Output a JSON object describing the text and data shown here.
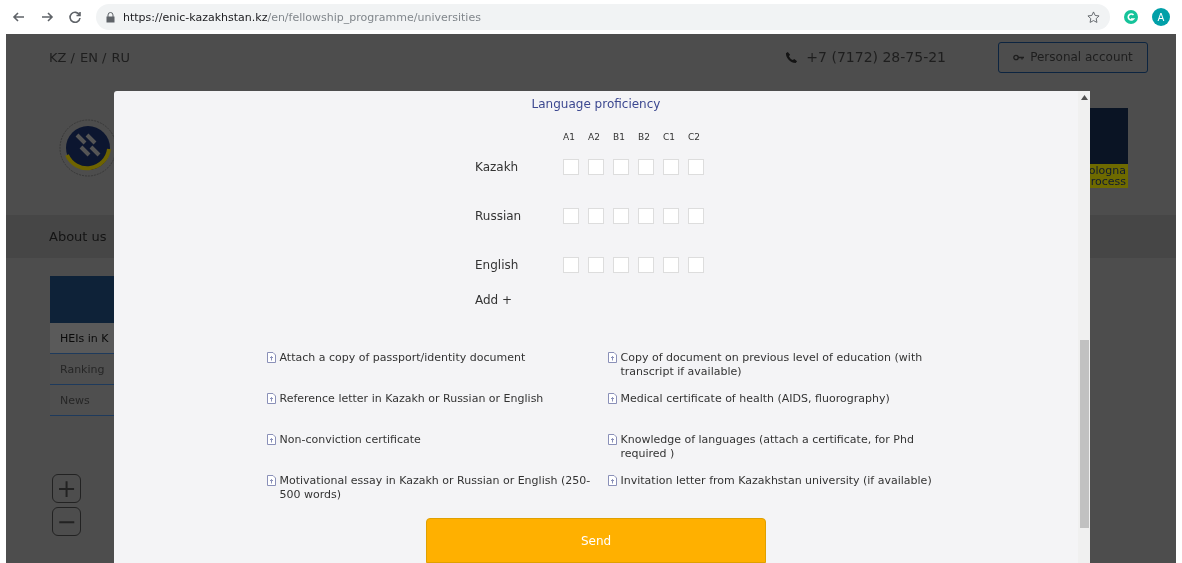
{
  "browser": {
    "url_host": "https://enic-kazakhstan.kz",
    "url_path": "/en/fellowship_programme/universities",
    "profile_initial": "A"
  },
  "site": {
    "languages": [
      "KZ /",
      "EN /",
      "RU"
    ],
    "phone": "+7 (7172) 28-75-21",
    "account_button": "Personal account",
    "right_logo_lines": [
      "ologna",
      "rocess"
    ],
    "nav": [
      "About us"
    ],
    "sidebar_items": [
      {
        "label": "HEIs in K",
        "selected": true
      },
      {
        "label": "Ranking",
        "selected": false
      },
      {
        "label": "News",
        "selected": false
      }
    ],
    "zoom_buttons": [
      "+",
      "−"
    ]
  },
  "modal": {
    "section_title": "Language proficiency",
    "levels": [
      "A1",
      "A2",
      "B1",
      "B2",
      "C1",
      "C2"
    ],
    "languages": [
      {
        "name": "Kazakh",
        "checked": [
          false,
          false,
          false,
          false,
          false,
          false
        ]
      },
      {
        "name": "Russian",
        "checked": [
          false,
          false,
          false,
          false,
          false,
          false
        ]
      },
      {
        "name": "English",
        "checked": [
          false,
          false,
          false,
          false,
          false,
          false
        ]
      }
    ],
    "add_link": "Add +",
    "documents": [
      "Attach a copy of passport/identity document",
      "Copy of document on previous level of education (with transcript if available)",
      "Reference letter in Kazakh or Russian or English",
      "Medical certificate of health (AIDS, fluorography)",
      "Non-conviction certificate",
      "Knowledge of languages (attach a certificate, for Phd required )",
      "Motivational essay in Kazakh or Russian or English (250-500 words)",
      "Invitation letter from Kazakhstan university (if available)"
    ],
    "send_button": "Send"
  }
}
